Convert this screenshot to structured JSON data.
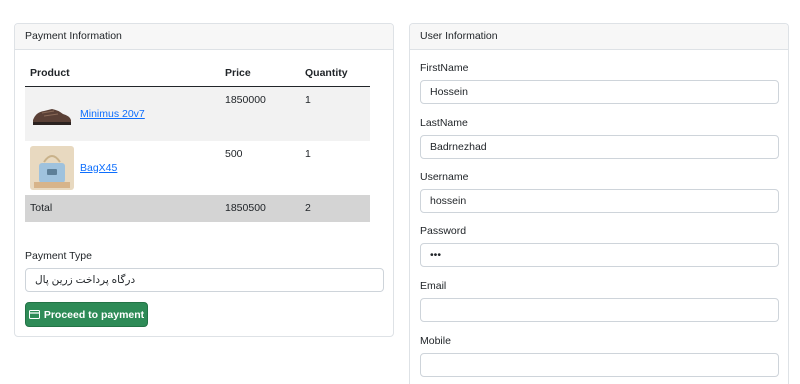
{
  "payment": {
    "header": "Payment Information",
    "columns": [
      "Product",
      "Price",
      "Quantity"
    ],
    "rows": [
      {
        "name": "Minimus 20v7",
        "price": "1850000",
        "quantity": "1"
      },
      {
        "name": "BagX45",
        "price": "500",
        "quantity": "1"
      }
    ],
    "total": {
      "label": "Total",
      "price": "1850500",
      "quantity": "2"
    },
    "payment_type_label": "Payment Type",
    "payment_type_value": "درگاه پرداخت زرین پال",
    "proceed_label": "Proceed to payment"
  },
  "user": {
    "header": "User Information",
    "fields": [
      {
        "label": "FirstName",
        "value": "Hossein"
      },
      {
        "label": "LastName",
        "value": "Badrnezhad"
      },
      {
        "label": "Username",
        "value": "hossein"
      },
      {
        "label": "Password",
        "value": "•••"
      },
      {
        "label": "Email",
        "value": ""
      },
      {
        "label": "Mobile",
        "value": ""
      }
    ]
  },
  "colors": {
    "primary_link": "#0d6efd",
    "success": "#2e8b57",
    "total_row": "#d4d4d4"
  }
}
